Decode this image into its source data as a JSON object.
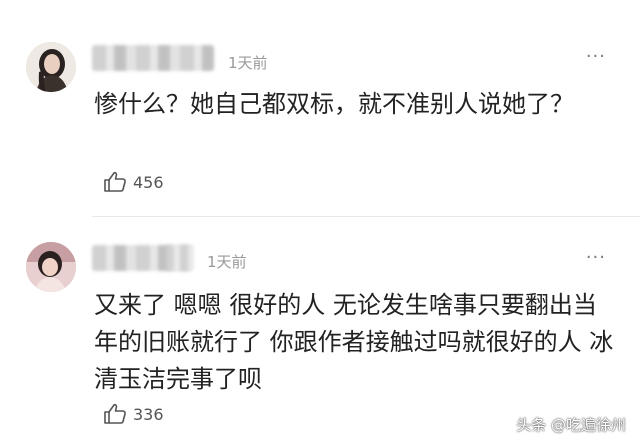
{
  "comments": [
    {
      "time": "1天前",
      "more": "···",
      "text": "惨什么？她自己都双标，就不准别人说她了？",
      "likes": "456"
    },
    {
      "time": "1天前",
      "more": "···",
      "text": "又来了 嗯嗯 很好的人 无论发生啥事只要翻出当年的旧账就行了 你跟作者接触过吗就很好的人 冰清玉洁完事了呗",
      "likes": "336"
    }
  ],
  "watermark": "头条 @吃遍徐州"
}
